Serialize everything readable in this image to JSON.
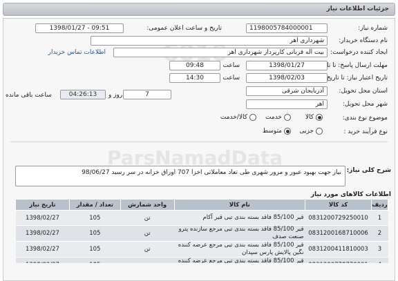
{
  "page_title": "جزئیات اطلاعات نیاز",
  "fields": {
    "need_number_label": "شماره نیاز:",
    "need_number": "1198005784000001",
    "announce_date_label": "تاریخ و ساعت اعلان عمومی:",
    "announce_datetime": "1398/01/27 - 09:51",
    "buyer_name_label": "نام دستگاه خریدار:",
    "buyer_name": "شهرداری اهر",
    "creator_label": "ایجاد کننده درخواست:",
    "creator": "بیت اله قربانی کارپرداز شهرداری اهر",
    "contact_link": "اطلاعات تماس خریدار",
    "send_deadline_label": "مهلت ارسال پاسخ: تا تاریخ:",
    "send_deadline_date": "1398/01/27",
    "time_label": "ساعت",
    "send_deadline_time": "09:48",
    "validity_label": "تاریخ اعتبار نیاز: تا تاریخ:",
    "validity_date": "1398/02/03",
    "validity_time": "14:30",
    "days_value": "7",
    "days_label": "روز و",
    "remaining_time": "04:26:13",
    "remaining_label": "ساعت باقی مانده",
    "province_label": "استان محل تحویل:",
    "province": "آذربایجان شرقی",
    "city_label": "شهر محل تحویل:",
    "city": "اهر",
    "category_label": "موضوع نوع بندی:",
    "category_options": [
      "کالا",
      "خدمت",
      "کالا/خدمت"
    ],
    "category_selected": "کالا",
    "process_label": "نوع فرآیند خرید :",
    "process_options": [
      "جزیی",
      "متوسط"
    ],
    "process_selected": "متوسط"
  },
  "need_desc_label": "شرح کلی نیاز:",
  "need_desc": "نیاز جهت بهبود عبور و مرور شهری طی تعاد معاملاتی اخزا 707 اوراق خزانه در سر رسید 98/06/27",
  "goods_section_title": "اطلاعات کالاهای مورد نیاز",
  "table": {
    "headers": [
      "ردیف",
      "کد کالا",
      "نام کالا",
      "واحد شمارش",
      "تعداد / مقدار",
      "تاریخ نیاز"
    ],
    "rows": [
      [
        "1",
        "0831200729250010",
        "قیر 85/100 فاقد بسته بندی تبی قیر آکام",
        "تن",
        "105",
        "1398/02/27"
      ],
      [
        "2",
        "0831200168710006",
        "قیر 85/100 فاقد بسته بندی تبی مرجع سازنده پترو صنعت صدف",
        "تن",
        "105",
        "1398/02/27"
      ],
      [
        "3",
        "0831200411810003",
        "قیر 85/100 فاقد بسته بندی تبی مرجع عرضه کننده نگین پالایش پارس سپدان",
        "تن",
        "105",
        "1398/02/27"
      ],
      [
        "4",
        "0831200778770001",
        "قیر 85/100 فاقد بسته بندی تبی مرجع عرضه کننده نگین گام پارس",
        "تن",
        "105",
        "1398/02/27"
      ],
      [
        "5",
        "0831200618870002",
        "قیر 85/100 فاقد بسته بندی تبی مرجع عرضه کننده شرکت",
        "تن",
        "105",
        "1398/02/27"
      ]
    ]
  },
  "watermark": {
    "brand": "ParsNamadData",
    "line1": "پایگاه اطلاع رسانی مناقصه و مزایده",
    "phone": "۰۲۱-۸۸۳۴۹۶۷۰",
    "code": "6010"
  }
}
